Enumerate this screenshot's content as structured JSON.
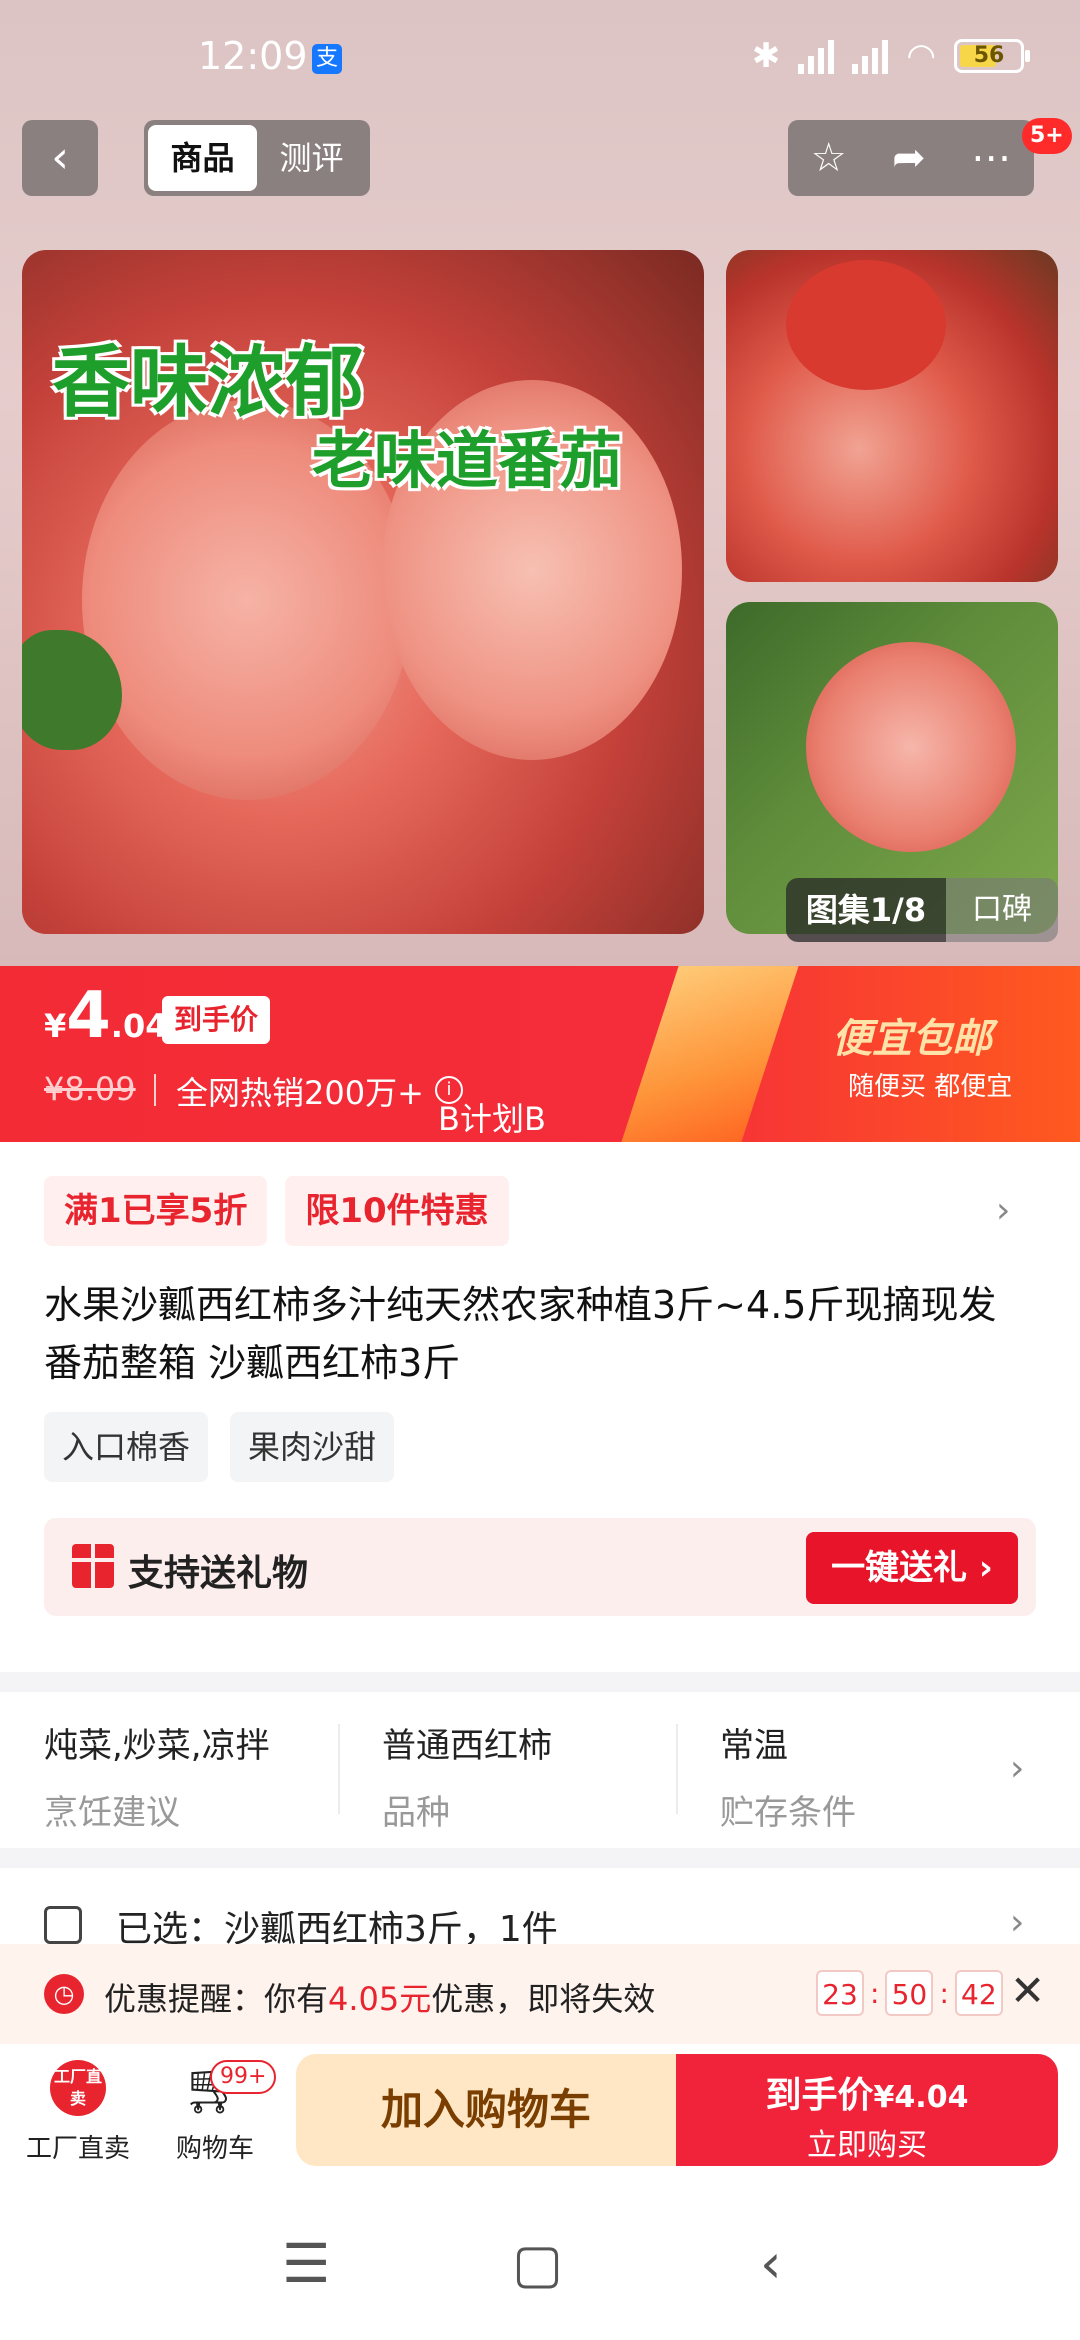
{
  "status_bar": {
    "time": "12:09",
    "alipay_label": "支",
    "battery": "56"
  },
  "nav": {
    "back_label": "‹",
    "tabs": [
      {
        "label": "商品",
        "active": true
      },
      {
        "label": "测评",
        "active": false
      }
    ],
    "icons": [
      "star-icon",
      "share-icon",
      "more-icon"
    ],
    "badge": "5+"
  },
  "hero": {
    "caption_line1": "香味浓郁",
    "caption_line2": "老味道番茄",
    "gallery_label": "图集1/8",
    "review_label": "口碑"
  },
  "price": {
    "symbol": "¥",
    "integer": "4",
    "decimal": ".04",
    "tag": "到手价",
    "original": "¥8.09",
    "hot_sales": "全网热销200万+",
    "plan_label": "B计划B",
    "promo_title": "便宜包邮",
    "promo_sub": "随便买 都便宜"
  },
  "coupons": [
    "满1已享5折",
    "限10件特惠"
  ],
  "product": {
    "title": "水果沙瓤西红柿多汁纯天然农家种植3斤~4.5斤现摘现发番茄整箱 沙瓤西红柿3斤",
    "tags": [
      "入口棉香",
      "果肉沙甜"
    ]
  },
  "gift": {
    "text": "支持送礼物",
    "button": "一键送礼 ›"
  },
  "attributes": [
    {
      "value": "炖菜,炒菜,凉拌",
      "key": "烹饪建议"
    },
    {
      "value": "普通西红柿",
      "key": "品种"
    },
    {
      "value": "常温",
      "key": "贮存条件"
    }
  ],
  "selected": {
    "text": "已选：沙瓤西红柿3斤，1件"
  },
  "reminder": {
    "prefix": "优惠提醒：你有",
    "amount": "4.05元",
    "suffix": "优惠，即将失效",
    "countdown": [
      "23",
      "50",
      "42"
    ]
  },
  "bottom_bar": {
    "factory_icon_text": "工厂直卖",
    "factory_label": "工厂直卖",
    "cart_label": "购物车",
    "cart_badge": "99+",
    "add_to_cart": "加入购物车",
    "buy_line1": "到手价",
    "buy_price": "¥4.04",
    "buy_line2": "立即购买"
  },
  "colors": {
    "accent": "#e8242f",
    "cart_button_bg": "#ffe7c6",
    "buy_button_bg": "#f0233a"
  }
}
